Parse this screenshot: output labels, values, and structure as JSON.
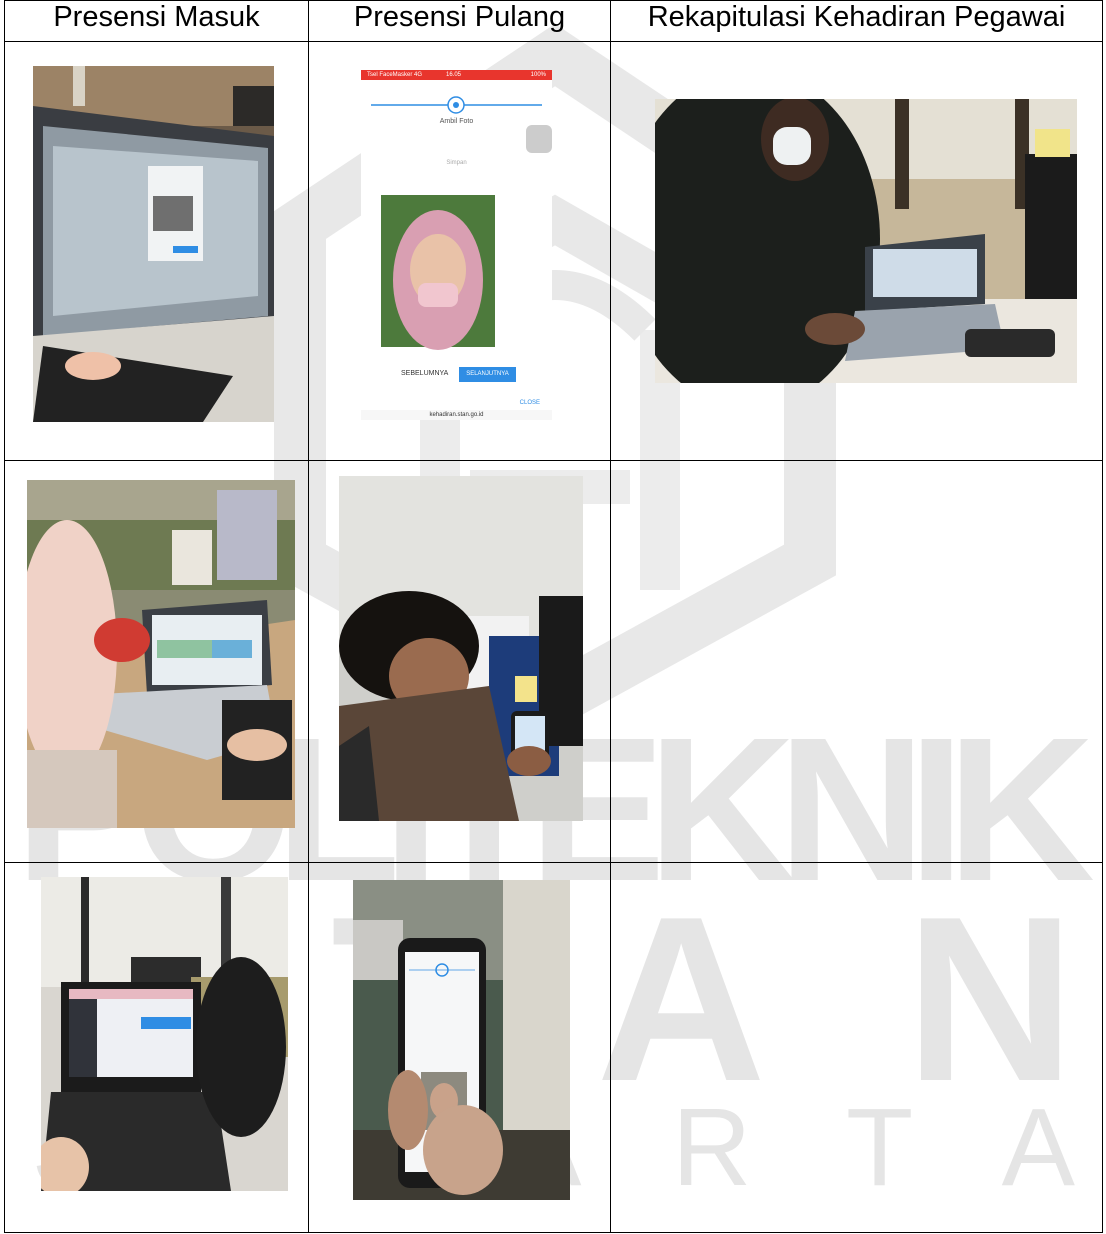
{
  "watermark": {
    "word_politeknik": "POLITEKNIK",
    "word_stan": "STAN",
    "word_jakarta": "J A K A R T A"
  },
  "table": {
    "headers": [
      "Presensi Masuk",
      "Presensi Pulang",
      "Rekapitulasi Kehadiran Pegawai"
    ]
  },
  "phone_screen": {
    "status_bar": "Tsel FaceMasker 4G",
    "time": "16.05",
    "battery": "100%",
    "step_label": "Ambil Foto",
    "step_label_2": "Simpan",
    "prev_button": "SEBELUMNYA",
    "next_button": "SELANJUTNYA",
    "close_label": "CLOSE",
    "footer_url": "kehadiran.stan.go.id"
  },
  "colors": {
    "watermark": "#e9e9e9",
    "accent_blue": "#2f8de4",
    "status_red": "#e8352d"
  }
}
